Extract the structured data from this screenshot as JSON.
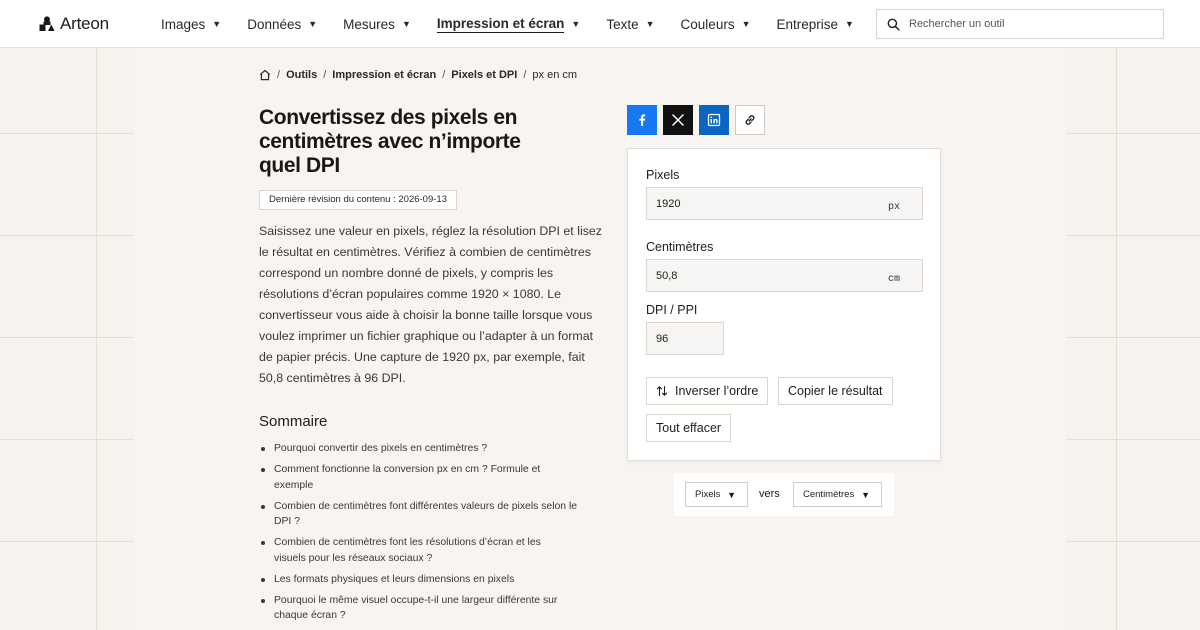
{
  "header": {
    "logo_text": "Arteon",
    "nav": [
      {
        "label": "Images"
      },
      {
        "label": "Données"
      },
      {
        "label": "Mesures"
      },
      {
        "label": "Impression et écran",
        "active": true
      },
      {
        "label": "Texte"
      },
      {
        "label": "Couleurs"
      },
      {
        "label": "Entreprise"
      }
    ],
    "search_placeholder": "Rechercher un outil"
  },
  "breadcrumb": [
    "Outils",
    "Impression et écran",
    "Pixels et DPI",
    "px en cm"
  ],
  "page": {
    "title": "Convertissez des pixels en centimètres avec n’importe quel DPI",
    "revision": "Dernière révision du contenu : 2026-09-13",
    "intro": "Saisissez une valeur en pixels, réglez la résolution DPI et lisez le résultat en centimètres. Vérifiez à combien de centimètres correspond un nombre donné de pixels, y compris les résolutions d’écran populaires comme 1920 × 1080. Le convertisseur vous aide à choisir la bonne taille lorsque vous voulez imprimer un fichier graphique ou l’adapter à un format de papier précis. Une capture de 1920 px, par exemple, fait 50,8 centimètres à 96 DPI."
  },
  "toc": {
    "title": "Sommaire",
    "items": [
      "Pourquoi convertir des pixels en centimètres ?",
      "Comment fonctionne la conversion px en cm ? Formule et exemple",
      "Combien de centimètres font différentes valeurs de pixels selon le DPI ?",
      "Combien de centimètres font les résolutions d’écran et les visuels pour les réseaux sociaux ?",
      "Les formats physiques et leurs dimensions en pixels",
      "Pourquoi le même visuel occupe-t-il une largeur différente sur chaque écran ?"
    ]
  },
  "converter": {
    "pixels_label": "Pixels",
    "pixels_value": "1920",
    "pixels_unit": "px",
    "cm_label": "Centimètres",
    "cm_value": "50,8",
    "cm_unit": "cm",
    "dpi_label": "DPI / PPI",
    "dpi_value": "96",
    "swap_label": "Inverser l’ordre",
    "copy_label": "Copier le résultat",
    "clear_label": "Tout effacer"
  },
  "direction": {
    "from": "Pixels",
    "connector": "vers",
    "to": "Centimètres"
  },
  "icons": {
    "home": "home-icon",
    "search": "search-icon",
    "facebook": "facebook-icon",
    "x": "x-icon",
    "linkedin": "linkedin-icon",
    "link": "link-icon",
    "swap": "swap-arrows-icon"
  },
  "colors": {
    "facebook": "#1877f2",
    "x": "#111111",
    "linkedin": "#0a66c2"
  }
}
